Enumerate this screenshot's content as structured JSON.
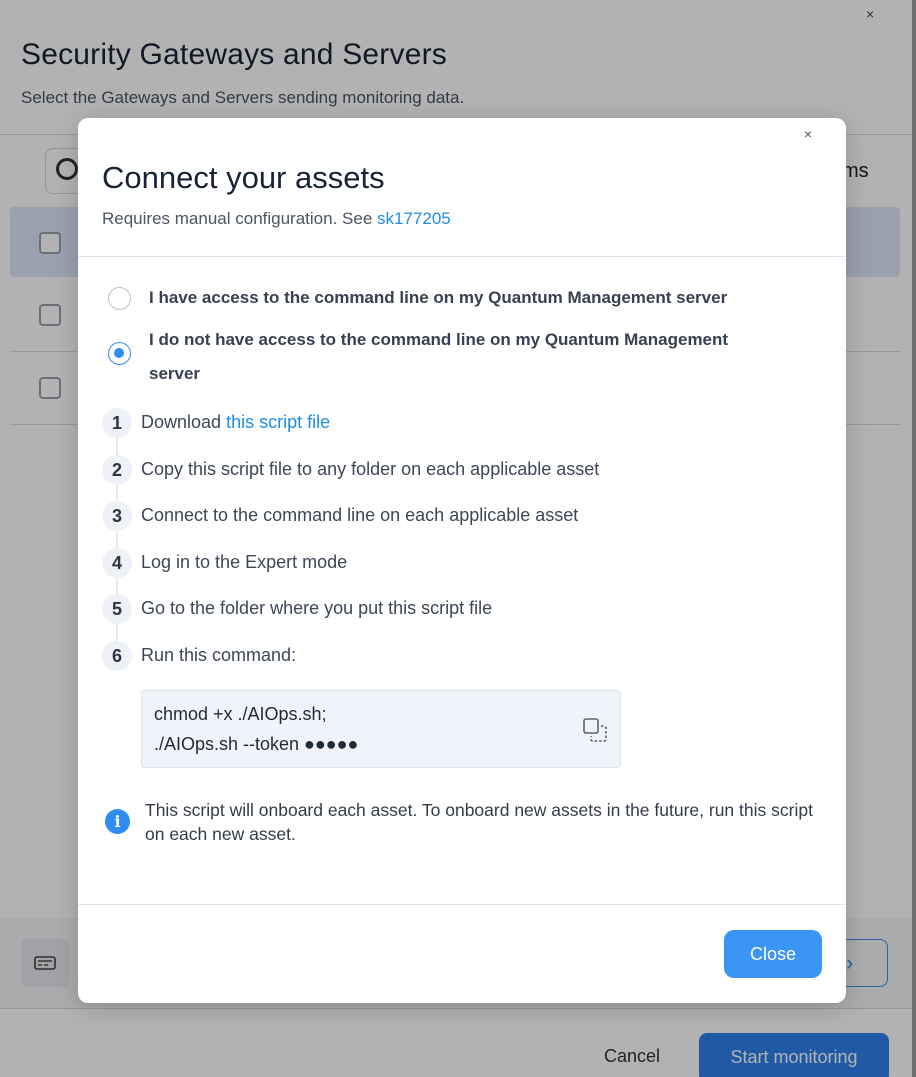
{
  "background": {
    "close_glyph": "×",
    "title": "Security Gateways and Servers",
    "subtitle": "Select the Gateways and Servers sending monitoring data.",
    "items_fragment": "ms",
    "cancel_label": "Cancel",
    "start_label": "Start monitoring",
    "next_glyph": "›"
  },
  "modal": {
    "close_glyph": "×",
    "title": "Connect your assets",
    "subtitle_prefix": "Requires manual configuration. See ",
    "subtitle_link": "sk177205",
    "options": [
      {
        "label": "I have access to the command line on my Quantum Management server",
        "checked": false
      },
      {
        "label_line1": "I do not have access to the command line on my Quantum Management",
        "label_line2": "server",
        "checked": true
      }
    ],
    "steps": [
      {
        "num": "1",
        "text": "Download ",
        "link": "this script file"
      },
      {
        "num": "2",
        "text": "Copy this script file to any folder on each applicable asset"
      },
      {
        "num": "3",
        "text": "Connect to the command line on each applicable asset"
      },
      {
        "num": "4",
        "text": "Log in to the Expert mode"
      },
      {
        "num": "5",
        "text": "Go to the folder where you put this script file"
      },
      {
        "num": "6",
        "text": "Run this command:"
      }
    ],
    "code": {
      "line1": "chmod +x ./AIOps.sh;",
      "line2": "./AIOps.sh --token ●●●●●"
    },
    "info_glyph": "i",
    "info_text": "This script will onboard each asset. To onboard new assets in the future, run this script on each new asset.",
    "close_button": "Close"
  },
  "colors": {
    "accent": "#2f8cf0",
    "link": "#1f8ce6",
    "primary_button": "#3b95f5"
  }
}
